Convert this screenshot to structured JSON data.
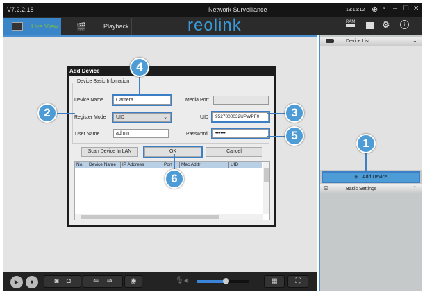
{
  "titlebar": {
    "version": "V7.2.2.18",
    "title": "Network Surveillance",
    "time": "13:15:12"
  },
  "tabs": [
    {
      "label": "Live View"
    },
    {
      "label": "Playback"
    }
  ],
  "logo": "reolink",
  "header_icons": {
    "ram": "RAM"
  },
  "dialog": {
    "title": "Add Device",
    "section": "Device Basic Infomation",
    "device_name_label": "Device Name",
    "device_name": "Camera",
    "media_port_label": "Media Port",
    "media_port": "",
    "register_mode_label": "Register Mode",
    "register_mode": "UID",
    "uid_label": "UID",
    "uid": "9527000032UPWPF0",
    "user_name_label": "User Name",
    "user_name": "admin",
    "password_label": "Password",
    "password": "••••••",
    "scan_button": "Scan Device In LAN",
    "ok_button": "OK",
    "cancel_button": "Cancel",
    "columns": [
      "No.",
      "Device Name",
      "IP Address",
      "Port",
      "Mac Addr",
      "UID"
    ]
  },
  "right_panel": {
    "device_list": "Device List",
    "add_device": "Add Device",
    "basic_settings": "Basic Settings"
  },
  "callouts": [
    "1",
    "2",
    "3",
    "4",
    "5",
    "6"
  ],
  "volume_fraction": 0.55,
  "colors": {
    "accent": "#4a8fd0",
    "callout": "#4e9cd6",
    "dark": "#232323"
  }
}
